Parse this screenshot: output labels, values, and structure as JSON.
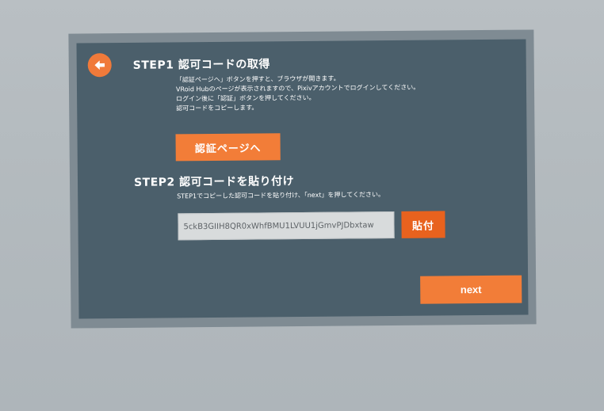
{
  "step1": {
    "title": "STEP1 認可コードの取得",
    "description": [
      "「認証ページへ」ボタンを押すと、ブラウザが開きます。",
      "VRoid Hubのページが表示されますので、Pixivアカウントでログインしてください。",
      "ログイン後に「認証」ボタンを押してください。",
      "認可コードをコピーします。"
    ],
    "auth_button_label": "認証ページへ"
  },
  "step2": {
    "title": "STEP2 認可コードを貼り付け",
    "description": "STEP1でコピーした認可コードを貼り付け、「next」を押してください。",
    "code_value": "5ckB3GIIH8QR0xWhfBMU1LVUU1jGmvPJDbxtaw",
    "paste_button_label": "貼付"
  },
  "next_button_label": "next",
  "icons": {
    "back": "back-arrow-icon"
  },
  "colors": {
    "accent": "#f27d38",
    "accent_dark": "#e8621e",
    "panel": "#4b5f6b",
    "frame": "#7f8b93",
    "background": "#b2b9be"
  }
}
